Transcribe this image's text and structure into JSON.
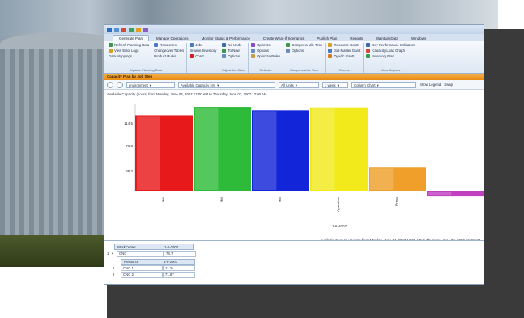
{
  "tabs": [
    "Generate Plan",
    "Manage Operations",
    "Monitor Status & Performance",
    "Create What-If Scenarios",
    "Publish Plan",
    "Reports",
    "Maintain Data",
    "Windows"
  ],
  "ribbon": {
    "groups": [
      {
        "title": "Update Planning Data",
        "items": [
          "Refresh Planning Data",
          "View Error Logs",
          "Data Mappings",
          "Resources",
          "Changeover Tables",
          "Product Rules"
        ]
      },
      {
        "title": "",
        "items": [
          "Jobs",
          "Browse Inventory",
          "Chart..."
        ]
      },
      {
        "title": "Adjust the Chart",
        "items": [
          "No Undo",
          "To Now",
          "Options"
        ]
      },
      {
        "title": "Optimize",
        "items": [
          "Optimize",
          "Options",
          "Optimize Rules"
        ]
      },
      {
        "title": "Compress Idle Time",
        "items": [
          "Compress Idle Time",
          "Options"
        ]
      },
      {
        "title": "Events",
        "items": [
          "Resource Gantt",
          "Job Master Gantt",
          "Dyadic Gantt"
        ]
      },
      {
        "title": "View Reports",
        "items": [
          "Key Performance Indicators",
          "Capacity Load Graph",
          "Inventory Plan"
        ]
      }
    ]
  },
  "section_title": "Capacity Plan by Job Step",
  "filters": {
    "environment": "environment",
    "capacity": "Available Capacity Hrs",
    "all_units": "All Units",
    "period": "1 week",
    "chart_type": "Column Chart",
    "show_legend": "Show Legend",
    "swap": "Swap"
  },
  "chart_caption": "Available Capacity (hours) from Monday, June 04, 2007 12:00 AM to Thursday, June 07, 2007 12:00 AM",
  "chart_footer": "Available Capacity (hours) from Monday, June 04, 2007 12:00 AM to Thursday, June 07, 2007 12:00 AM",
  "chart_data": {
    "type": "bar",
    "categories": [
      "Mill",
      "Mill",
      "Mill",
      "Operation",
      "Press",
      ""
    ],
    "values": [
      153,
      170,
      163,
      169,
      47,
      -10
    ],
    "colors": [
      "#e8191b",
      "#2fbb3a",
      "#1325d8",
      "#f2ea1a",
      "#f0a02a",
      "#c040c0"
    ],
    "yticks": [
      "114.5",
      "76.3",
      "38.2"
    ],
    "xlabel": "1-6-2007"
  },
  "grid": {
    "header": {
      "col1": "WorkCenter",
      "col2": "1-6-2007"
    },
    "row1": {
      "id": "1",
      "name": "CNC",
      "value": "78.7"
    },
    "subheader": {
      "col1": "Resource",
      "col2": "1-6-2007"
    },
    "subrows": [
      {
        "id": "1",
        "name": "CNC 1",
        "value": "11.34"
      },
      {
        "id": "2",
        "name": "CNC 2",
        "value": "71.87"
      }
    ]
  }
}
